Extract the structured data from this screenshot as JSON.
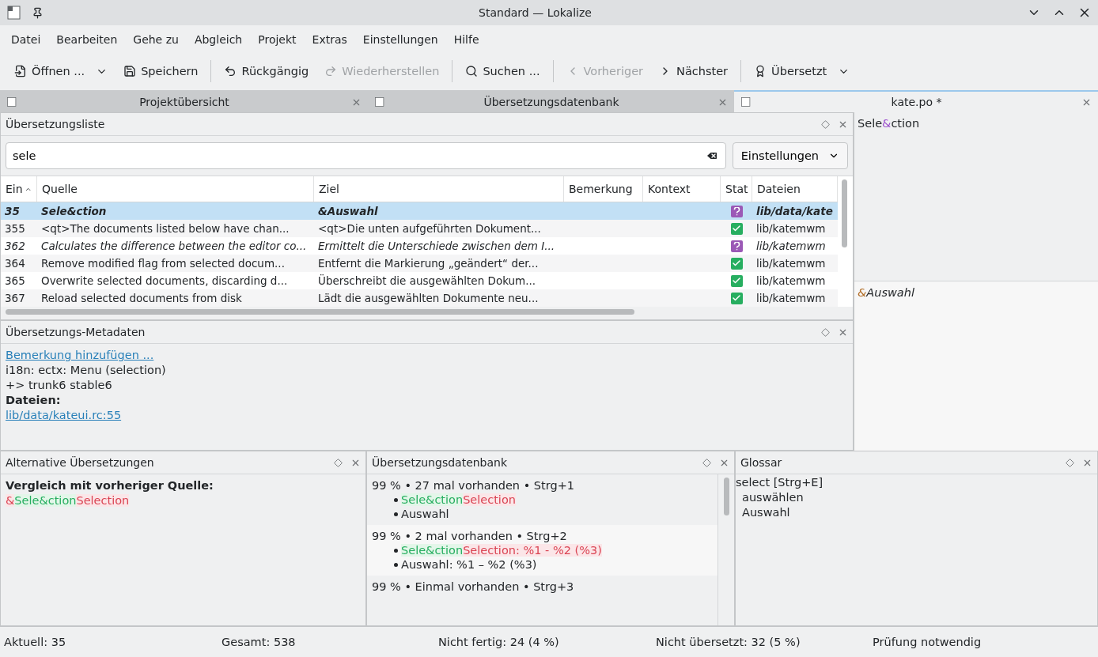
{
  "window": {
    "title": "Standard — Lokalize"
  },
  "menu": [
    "Datei",
    "Bearbeiten",
    "Gehe zu",
    "Abgleich",
    "Projekt",
    "Extras",
    "Einstellungen",
    "Hilfe"
  ],
  "toolbar": [
    {
      "kind": "open",
      "label": "Öffnen ...",
      "disabled": false,
      "dropdown": true
    },
    {
      "kind": "save",
      "label": "Speichern",
      "disabled": false,
      "dropdown": false
    },
    {
      "kind": "separator"
    },
    {
      "kind": "undo",
      "label": "Rückgängig",
      "disabled": false,
      "dropdown": false
    },
    {
      "kind": "redo",
      "label": "Wiederherstellen",
      "disabled": true,
      "dropdown": false
    },
    {
      "kind": "separator"
    },
    {
      "kind": "search",
      "label": "Suchen ...",
      "disabled": false,
      "dropdown": false
    },
    {
      "kind": "separator"
    },
    {
      "kind": "previous",
      "label": "Vorheriger",
      "disabled": true,
      "dropdown": false
    },
    {
      "kind": "next",
      "label": "Nächster",
      "disabled": false,
      "dropdown": false
    },
    {
      "kind": "separator"
    },
    {
      "kind": "state",
      "label": "Übersetzt",
      "disabled": false,
      "dropdown": true
    }
  ],
  "tabs": [
    {
      "label": "Projektübersicht",
      "selected": false
    },
    {
      "label": "Übersetzungsdatenbank",
      "selected": false
    },
    {
      "label": "kate.po *",
      "selected": true
    }
  ],
  "translation_list": {
    "title": "Übersetzungsliste",
    "search": {
      "value": "sele"
    },
    "settings_button": "Einstellungen",
    "columns": [
      {
        "label": "Ein",
        "sorted": true
      },
      {
        "label": "Quelle",
        "sorted": false
      },
      {
        "label": "Ziel",
        "sorted": false
      },
      {
        "label": "Bemerkung",
        "sorted": false
      },
      {
        "label": "Kontext",
        "sorted": false
      },
      {
        "label": "Stat",
        "sorted": false
      },
      {
        "label": "Dateien",
        "sorted": false
      }
    ],
    "rows": [
      {
        "id": "35",
        "source": "Sele&ction",
        "target": "&Auswahl",
        "translated": false,
        "files": "lib/data/kate",
        "selected": true
      },
      {
        "id": "355",
        "source": "<qt>The documents listed below have chan...",
        "target": "<qt>Die unten aufgeführten Dokument...",
        "translated": true,
        "files": "lib/katemwm",
        "selected": false
      },
      {
        "id": "362",
        "source": "Calculates the difference between the editor co...",
        "target": "Ermittelt die Unterschiede zwischen dem I...",
        "translated": false,
        "files": "lib/katemwm",
        "selected": false
      },
      {
        "id": "364",
        "source": "Remove modified flag from selected docum...",
        "target": "Entfernt die Markierung „geändert“ der...",
        "translated": true,
        "files": "lib/katemwm",
        "selected": false
      },
      {
        "id": "365",
        "source": "Overwrite selected documents, discarding d...",
        "target": "Überschreibt die ausgewählten Dokum...",
        "translated": true,
        "files": "lib/katemwm",
        "selected": false
      },
      {
        "id": "367",
        "source": "Reload selected documents from disk",
        "target": "Lädt die ausgewählten Dokumente neu...",
        "translated": true,
        "files": "lib/katemwm",
        "selected": false
      }
    ]
  },
  "metadata": {
    "title": "Übersetzungs-Metadaten",
    "lines": [
      {
        "kind": "link",
        "text": "Bemerkung hinzufügen ..."
      },
      {
        "kind": "plain",
        "text": "i18n: ectx: Menu (selection)"
      },
      {
        "kind": "plain",
        "text": "+> trunk6 stable6"
      },
      {
        "kind": "bold",
        "text": "Dateien:"
      },
      {
        "kind": "link",
        "text": "lib/data/kateui.rc:55"
      }
    ]
  },
  "editor": {
    "source": [
      {
        "kind": "plain",
        "text": "Sele"
      },
      {
        "kind": "accel",
        "text": "&"
      },
      {
        "kind": "plain",
        "text": "ction"
      }
    ],
    "target": [
      {
        "kind": "accel",
        "text": "&"
      },
      {
        "kind": "plain",
        "text": "Auswahl"
      }
    ]
  },
  "alternatives": {
    "title": "Alternative Übersetzungen",
    "heading": "Vergleich mit vorheriger Quelle:",
    "diff": [
      {
        "kind": "removed",
        "text": "&"
      },
      {
        "kind": "added",
        "text": "Sele&ction"
      },
      {
        "kind": "removed",
        "text": "Selection"
      }
    ]
  },
  "translation_memory": {
    "title": "Übersetzungsdatenbank",
    "entries": [
      {
        "header": "99 % • 27 mal vorhanden • Strg+1",
        "source": [
          {
            "kind": "added",
            "text": "Sele&ction"
          },
          {
            "kind": "removed",
            "text": "Selection"
          }
        ],
        "target": "Auswahl"
      },
      {
        "header": "99 % • 2 mal vorhanden • Strg+2",
        "source": [
          {
            "kind": "added",
            "text": "Sele&ction"
          },
          {
            "kind": "removed",
            "text": "Selection: %1 - %2 (%3)"
          }
        ],
        "target": "Auswahl: %1 – %2 (%3)"
      },
      {
        "header": "99 % • Einmal vorhanden • Strg+3"
      }
    ]
  },
  "glossary": {
    "title": "Glossar",
    "term": "select [Strg+E]",
    "translations": [
      "auswählen",
      "Auswahl"
    ]
  },
  "status_bar": [
    "Aktuell: 35",
    "Gesamt: 538",
    "Nicht fertig: 24 (4 %)",
    "Nicht übersetzt: 32 (5 %)",
    "Prüfung notwendig"
  ]
}
